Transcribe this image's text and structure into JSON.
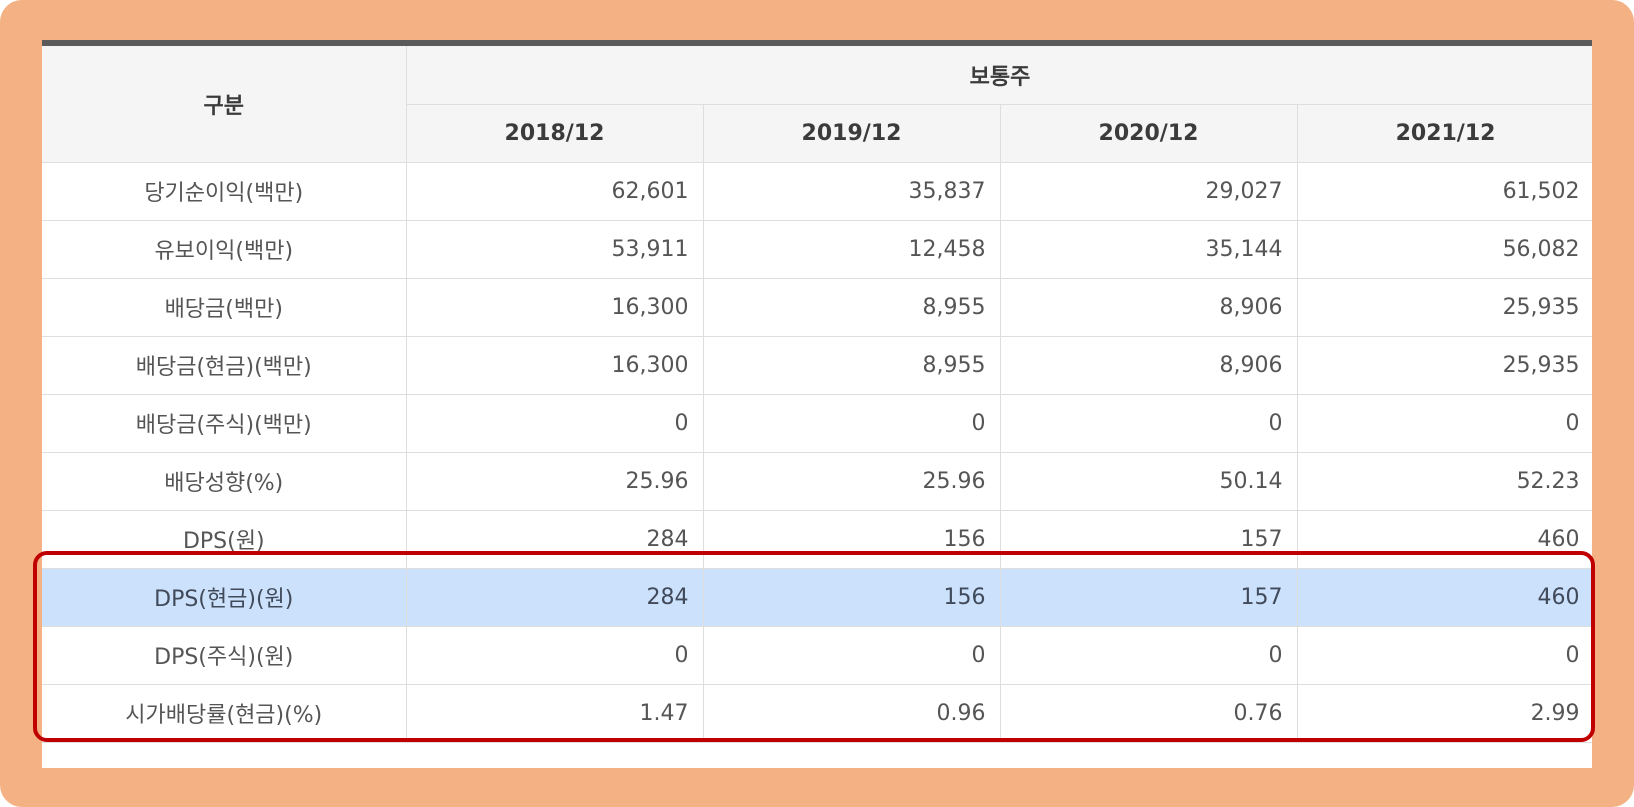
{
  "table": {
    "corner_header": "구분",
    "group_header": "보통주",
    "years": [
      "2018/12",
      "2019/12",
      "2020/12",
      "2021/12"
    ],
    "rows": [
      {
        "label": "당기순이익(백만)",
        "values": [
          "62,601",
          "35,837",
          "29,027",
          "61,502"
        ]
      },
      {
        "label": "유보이익(백만)",
        "values": [
          "53,911",
          "12,458",
          "35,144",
          "56,082"
        ]
      },
      {
        "label": "배당금(백만)",
        "values": [
          "16,300",
          "8,955",
          "8,906",
          "25,935"
        ]
      },
      {
        "label": "배당금(현금)(백만)",
        "values": [
          "16,300",
          "8,955",
          "8,906",
          "25,935"
        ]
      },
      {
        "label": "배당금(주식)(백만)",
        "values": [
          "0",
          "0",
          "0",
          "0"
        ]
      },
      {
        "label": "배당성향(%)",
        "values": [
          "25.96",
          "25.96",
          "50.14",
          "52.23"
        ]
      },
      {
        "label": "DPS(원)",
        "values": [
          "284",
          "156",
          "157",
          "460"
        ]
      },
      {
        "label": "DPS(현금)(원)",
        "values": [
          "284",
          "156",
          "157",
          "460"
        ]
      },
      {
        "label": "DPS(주식)(원)",
        "values": [
          "0",
          "0",
          "0",
          "0"
        ]
      },
      {
        "label": "시가배당률(현금)(%)",
        "values": [
          "1.47",
          "0.96",
          "0.76",
          "2.99"
        ]
      }
    ]
  },
  "colors": {
    "frame": "#f4b183",
    "highlight_row": "#cce1fb",
    "highlight_border": "#c00000",
    "header_bg": "#f5f5f5"
  }
}
